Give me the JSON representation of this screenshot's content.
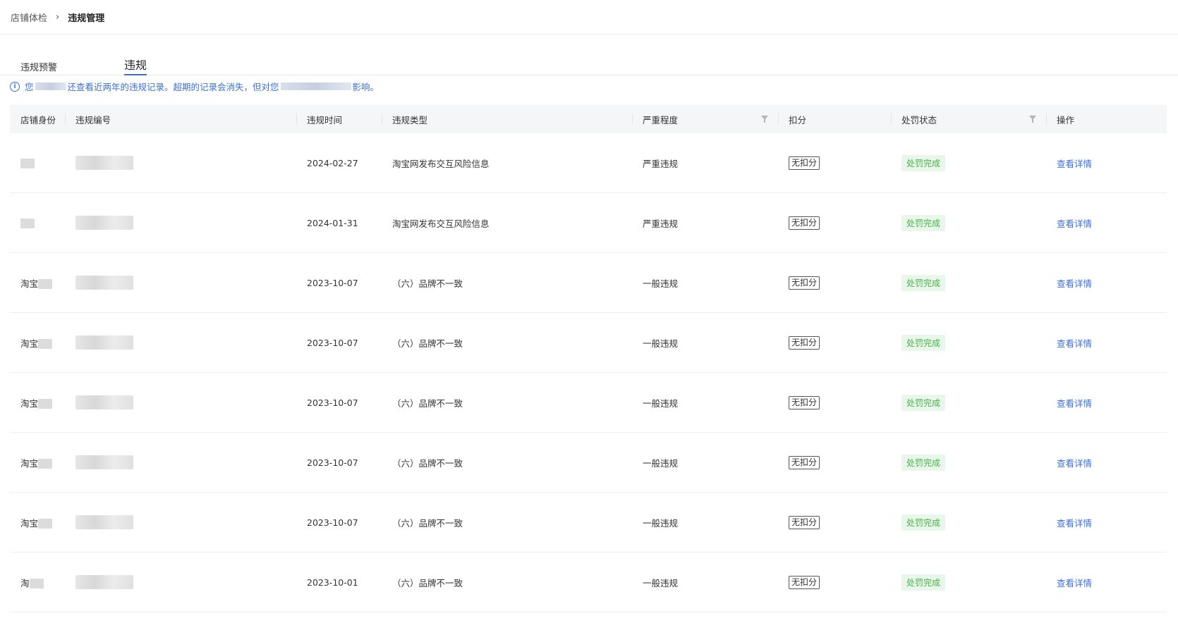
{
  "breadcrumb": {
    "parent": "店铺体检",
    "separator": "›",
    "current": "违规管理"
  },
  "tabs": [
    {
      "label": "违规预警",
      "active": false
    },
    {
      "label": "违规",
      "active": true
    }
  ],
  "notice": {
    "prefix": "您",
    "middle": "还查看近两年的违规记录。超期的记录会消失，但对您",
    "suffix": "影响。"
  },
  "table": {
    "headers": [
      "店铺身份",
      "违规编号",
      "违规时间",
      "违规类型",
      "严重程度",
      "扣分",
      "处罚状态",
      "操作"
    ],
    "rows": [
      {
        "shop": "",
        "date": "2024-02-27",
        "type": "淘宝网发布交互风险信息",
        "severity": "严重违规",
        "score": "无扣分",
        "status": "处罚完成",
        "action": "查看详情"
      },
      {
        "shop": "",
        "date": "2024-01-31",
        "type": "淘宝网发布交互风险信息",
        "severity": "严重违规",
        "score": "无扣分",
        "status": "处罚完成",
        "action": "查看详情"
      },
      {
        "shop": "淘宝",
        "date": "2023-10-07",
        "type": "（六）品牌不一致",
        "severity": "一般违规",
        "score": "无扣分",
        "status": "处罚完成",
        "action": "查看详情"
      },
      {
        "shop": "淘宝",
        "date": "2023-10-07",
        "type": "（六）品牌不一致",
        "severity": "一般违规",
        "score": "无扣分",
        "status": "处罚完成",
        "action": "查看详情"
      },
      {
        "shop": "淘宝",
        "date": "2023-10-07",
        "type": "（六）品牌不一致",
        "severity": "一般违规",
        "score": "无扣分",
        "status": "处罚完成",
        "action": "查看详情"
      },
      {
        "shop": "淘宝",
        "date": "2023-10-07",
        "type": "（六）品牌不一致",
        "severity": "一般违规",
        "score": "无扣分",
        "status": "处罚完成",
        "action": "查看详情"
      },
      {
        "shop": "淘宝",
        "date": "2023-10-07",
        "type": "（六）品牌不一致",
        "severity": "一般违规",
        "score": "无扣分",
        "status": "处罚完成",
        "action": "查看详情"
      },
      {
        "shop": "淘",
        "date": "2023-10-01",
        "type": "（六）品牌不一致",
        "severity": "一般违规",
        "score": "无扣分",
        "status": "处罚完成",
        "action": "查看详情"
      }
    ]
  },
  "colors": {
    "accent": "#3a6fe0",
    "status_bg": "#e9f7ea",
    "status_text": "#47b249",
    "header_bg": "#f5f6f8"
  }
}
